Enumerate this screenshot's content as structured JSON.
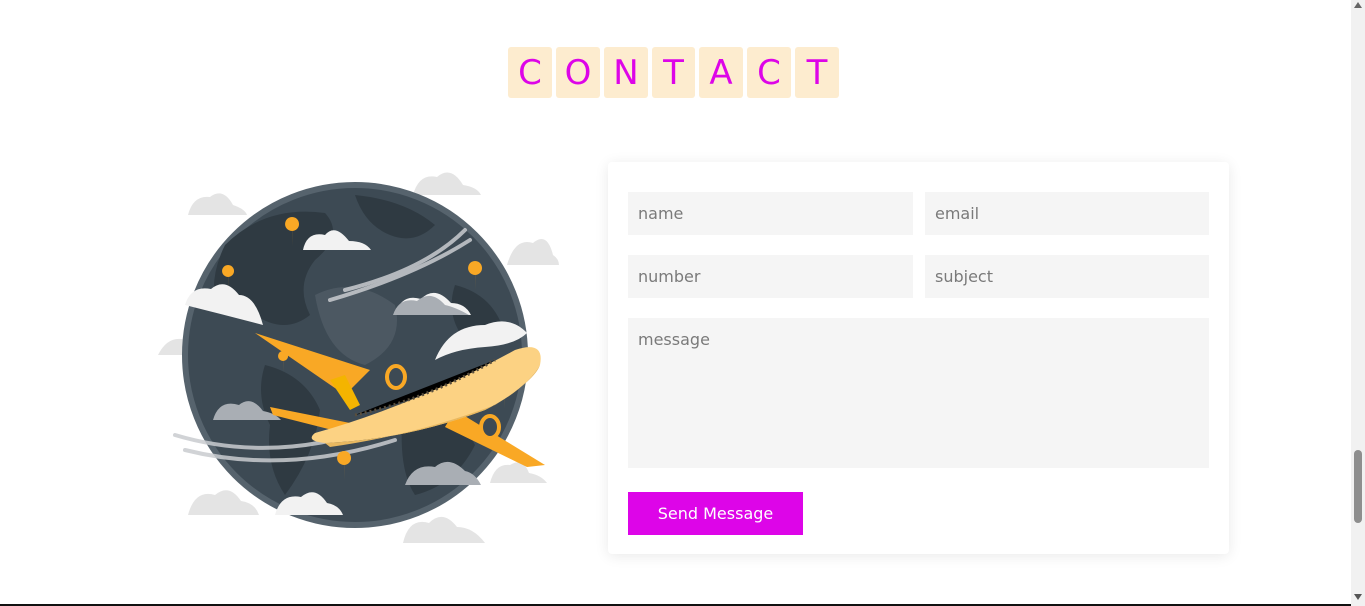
{
  "heading": {
    "letters": [
      "C",
      "O",
      "N",
      "T",
      "A",
      "C",
      "T"
    ]
  },
  "form": {
    "name_placeholder": "name",
    "email_placeholder": "email",
    "number_placeholder": "number",
    "subject_placeholder": "subject",
    "message_placeholder": "message",
    "send_label": "Send Message"
  },
  "colors": {
    "accent": "#dd05e8",
    "tile_background": "#fdeccf",
    "field_background": "#f5f5f5",
    "plane": "#f9a825",
    "globe": "#3d4a54"
  },
  "illustration": {
    "icon": "airplane-globe-illustration"
  }
}
